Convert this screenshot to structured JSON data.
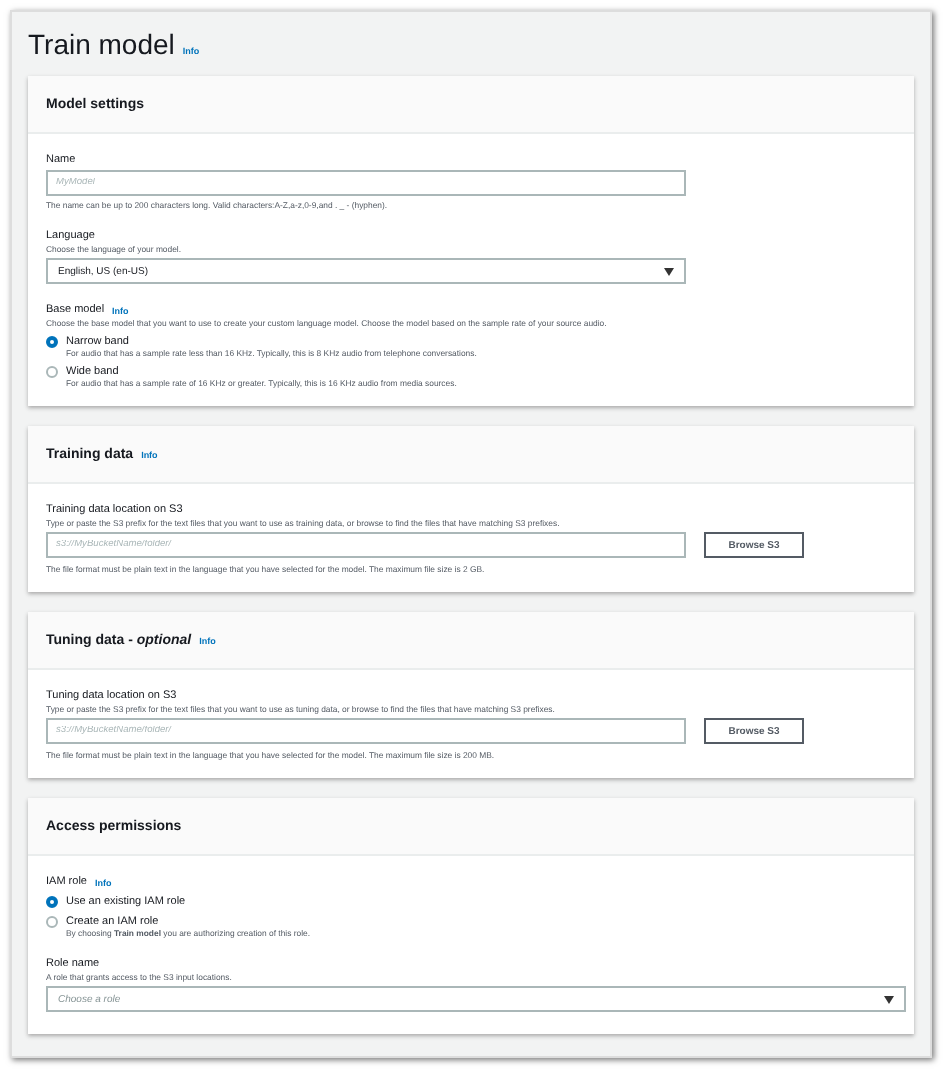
{
  "page": {
    "title": "Train model",
    "info": "Info"
  },
  "sections": [
    {
      "heading": "Model settings",
      "fields": [
        {
          "kind": "text",
          "label": "Name",
          "placeholder": "MyModel",
          "constraint": "The name can be up to 200 characters long. Valid characters:A-Z,a-z,0-9,and . _ - (hyphen)."
        },
        {
          "kind": "select",
          "label": "Language",
          "hint": "Choose the language of your model.",
          "value": "English, US (en-US)"
        },
        {
          "kind": "radio",
          "label": "Base model",
          "info": "Info",
          "hint": "Choose the base model that you want to use to create your custom language model. Choose the model based on the sample rate of your source audio.",
          "options": [
            {
              "label": "Narrow band",
              "description": "For audio that has a sample rate less than 16 KHz. Typically, this is 8 KHz audio from telephone conversations.",
              "selected": true
            },
            {
              "label": "Wide band",
              "description": "For audio that has a sample rate of 16 KHz or greater. Typically, this is 16 KHz audio from media sources.",
              "selected": false
            }
          ]
        }
      ]
    },
    {
      "heading": "Training data",
      "info": "Info",
      "fields": [
        {
          "kind": "s3",
          "label": "Training data location on S3",
          "hint": "Type or paste the S3 prefix for the text files that you want to use as training data, or browse to find the files that have matching S3 prefixes.",
          "placeholder": "s3://MyBucketName/folder/",
          "button": "Browse S3",
          "constraint": "The file format must be plain text in the language that you have selected for the model. The maximum file size is 2 GB."
        }
      ]
    },
    {
      "heading": "Tuning data - *optional*",
      "info": "Info",
      "fields": [
        {
          "kind": "s3",
          "label": "Tuning data location on S3",
          "hint": "Type or paste the S3 prefix for the text files that you want to use as tuning data, or browse to find the files that have matching S3 prefixes.",
          "placeholder": "s3://MyBucketName/folder/",
          "button": "Browse S3",
          "constraint": "The file format must be plain text in the language that you have selected for the model. The maximum file size is 200 MB."
        }
      ]
    },
    {
      "heading": "Access permissions",
      "fields": [
        {
          "kind": "radio",
          "label": "IAM role",
          "info": "Info",
          "options": [
            {
              "label": "Use an existing IAM role",
              "selected": true
            },
            {
              "label": "Create an IAM role",
              "description": "By choosing **Train model** you are authorizing creation of this role.",
              "selected": false
            }
          ]
        },
        {
          "kind": "select",
          "label": "Role name",
          "hint": "A role that grants access to the S3 input locations.",
          "placeholder": "Choose a role",
          "wide": true
        }
      ]
    }
  ]
}
